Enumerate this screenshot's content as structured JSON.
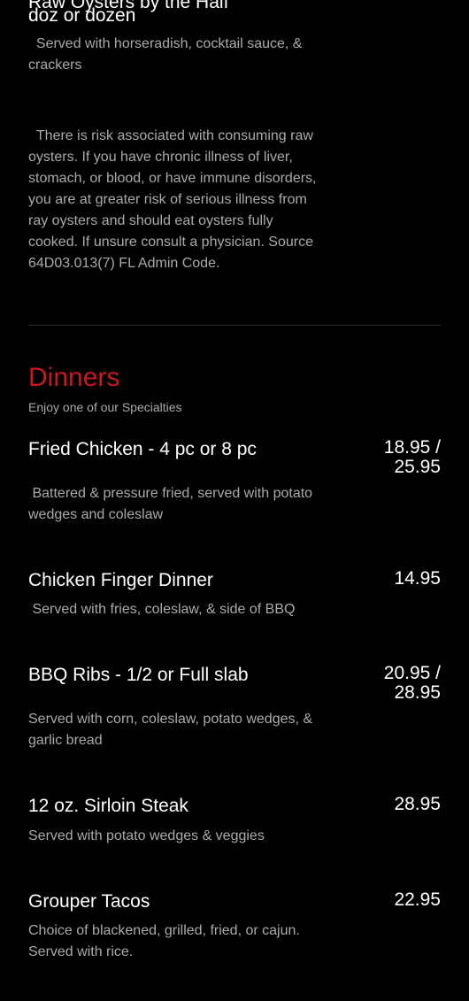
{
  "top_item": {
    "cut_title": "Raw Oysters by the Half",
    "title": "doz or dozen",
    "description": "  Served with horseradish, cocktail sauce, & crackers",
    "warning": "  There is risk associated with consuming raw oysters. If you have chronic illness of liver, stomach, or blood, or have immune disorders, you are at greater risk of serious illness from ray oysters and should eat oysters fully cooked. If unsure consult a physician. Source 64D03.013(7) FL Admin Code."
  },
  "section": {
    "title": "Dinners",
    "subtitle": "Enjoy one of our Specialties"
  },
  "items": [
    {
      "name": "Fried Chicken - 4 pc or 8 pc",
      "price": "18.95 /\n25.95",
      "description": " Battered & pressure fried, served with potato wedges and coleslaw"
    },
    {
      "name": "Chicken Finger Dinner",
      "price": "14.95",
      "description": " Served with fries, coleslaw, & side of BBQ"
    },
    {
      "name": "BBQ Ribs - 1/2 or Full slab",
      "price": "20.95 /\n28.95",
      "description": "Served with corn, coleslaw, potato wedges, & garlic bread"
    },
    {
      "name": "12 oz. Sirloin Steak",
      "price": "28.95",
      "description": "Served with potato wedges & veggies"
    },
    {
      "name": "Grouper Tacos",
      "price": "22.95",
      "description": "Choice of blackened, grilled, fried, or cajun. Served with rice."
    }
  ],
  "colors": {
    "background": "#000000",
    "text": "#ffffff",
    "muted": "#aaaaaa",
    "accent": "#c8191e"
  }
}
